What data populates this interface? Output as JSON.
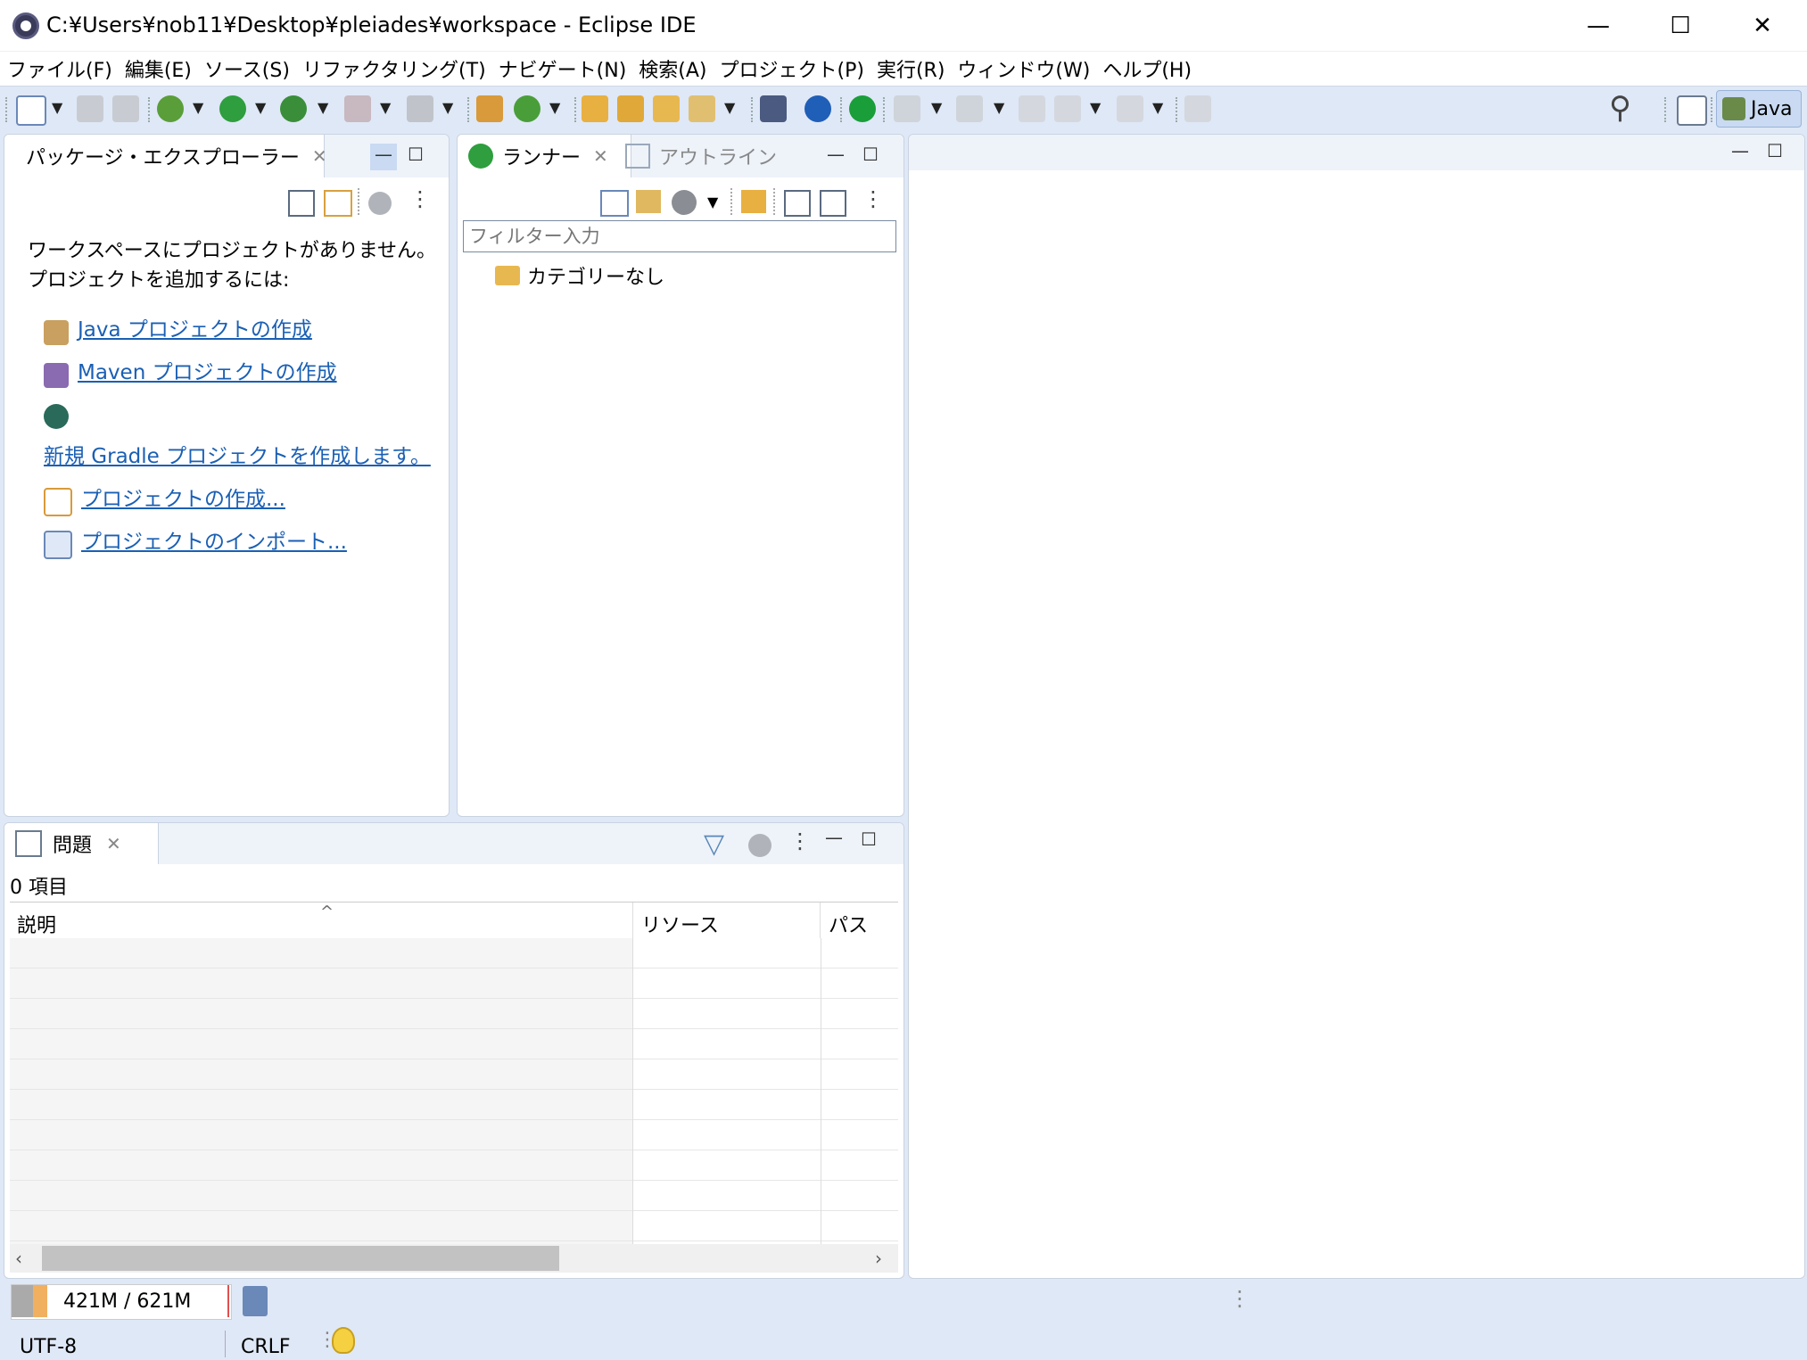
{
  "window": {
    "title": "C:¥Users¥nob11¥Desktop¥pleiades¥workspace - Eclipse IDE",
    "minimize_glyph": "—",
    "maximize_glyph": "☐",
    "close_glyph": "✕"
  },
  "menu": [
    "ファイル(F)",
    "編集(E)",
    "ソース(S)",
    "リファクタリング(T)",
    "ナビゲート(N)",
    "検索(A)",
    "プロジェクト(P)",
    "実行(R)",
    "ウィンドウ(W)",
    "ヘルプ(H)"
  ],
  "toolbar": {
    "perspective_label": "Java",
    "search_glyph": "⚲"
  },
  "package_explorer": {
    "tab_label": "パッケージ・エクスプローラー",
    "message_line1": "ワークスペースにプロジェクトがありません。",
    "message_line2": "プロジェクトを追加するには:",
    "links": [
      "Java プロジェクトの作成",
      "Maven プロジェクトの作成",
      "新規 Gradle プロジェクトを作成します。",
      "プロジェクトの作成...",
      "プロジェクトのインポート..."
    ]
  },
  "runner": {
    "tab_label": "ランナー",
    "outline_tab_label": "アウトライン",
    "filter_placeholder": "フィルター入力",
    "tree_item": "カテゴリーなし"
  },
  "problems": {
    "tab_label": "問題",
    "count_text": "0 項目",
    "columns": [
      "説明",
      "リソース",
      "パス"
    ],
    "sort_glyph": "^"
  },
  "statusbar": {
    "heap_text": "421M / 621M",
    "heap_used_fraction": 0.678,
    "encoding": "UTF-8",
    "line_delimiter": "CRLF"
  },
  "colors": {
    "workbench_bg": "#dfe8f6",
    "link": "#1a5fb4",
    "run_green": "#2e9e3e"
  }
}
